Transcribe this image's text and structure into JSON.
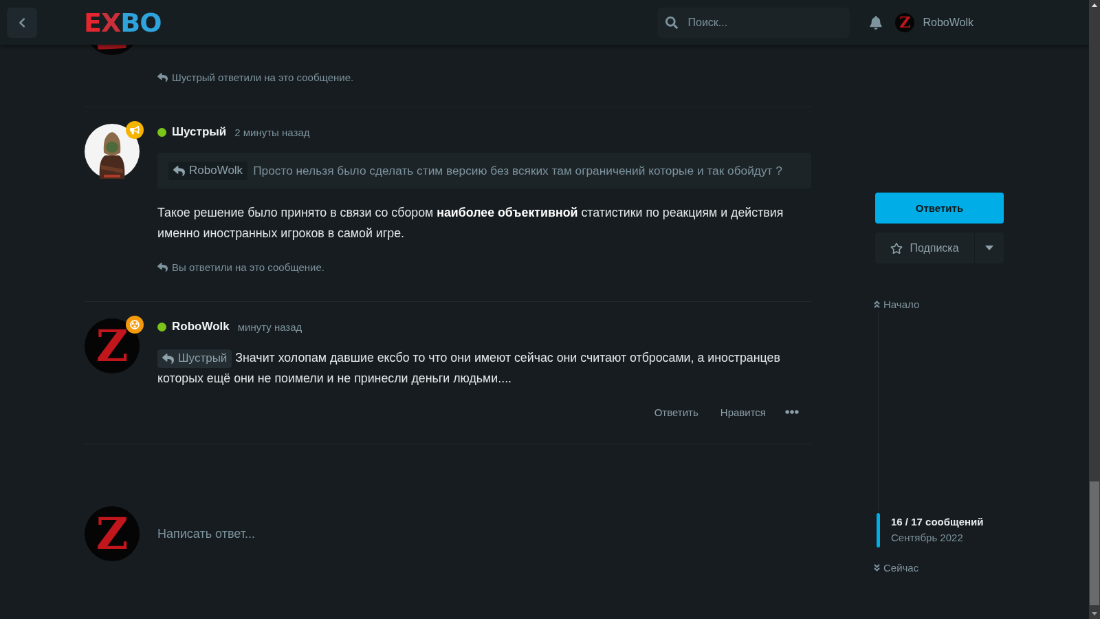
{
  "header": {
    "logo": [
      {
        "text": "E",
        "color": "#e3262f"
      },
      {
        "text": "X",
        "color": "#c9303a"
      },
      {
        "text": "BO",
        "color": "#2ea3dc"
      }
    ],
    "search": {
      "placeholder": "Поиск..."
    },
    "user": {
      "name": "RoboWolk",
      "avatar_letter": "Z"
    }
  },
  "posts": [
    {
      "avatar": {
        "kind": "cut"
      },
      "reply_note": "Шустрый ответили на это сообщение."
    },
    {
      "author": "Шустрый",
      "online": true,
      "time": "2 минуты назад",
      "badge": {
        "kind": "megaphone"
      },
      "quote": {
        "author": "RoboWolk",
        "text": "Просто нельзя было сделать стим версию без всяких там ограничений которые и так обойдут ?"
      },
      "body": "Такое решение было принято в связи со сбором **наиболее объективной** статистики по реакциям и действия именно иностранных игроков в самой игре.",
      "reply_note": "Вы ответили на это сообщение."
    },
    {
      "author": "RoboWolk",
      "online": true,
      "time": "минуту назад",
      "badge": {
        "kind": "radiation"
      },
      "avatar": {
        "kind": "letter",
        "letter": "Z"
      },
      "reply_to": "Шустрый",
      "body": "Значит холопам давшие ексбо то что они имеют сейчас они считают отбросами, а иностранцев которых ещё они не поимели и не принесли деньги людьми....",
      "actions": [
        "Ответить",
        "Нравится"
      ]
    }
  ],
  "composer": {
    "avatar_letter": "Z",
    "placeholder": "Написать ответ..."
  },
  "sidebar": {
    "reply_button": "Ответить",
    "subscribe_button": "Подписка",
    "scrubber": {
      "top": "Начало",
      "position": "16 / 17 сообщений",
      "date": "Сентябрь 2022",
      "bottom": "Сейчас"
    }
  }
}
